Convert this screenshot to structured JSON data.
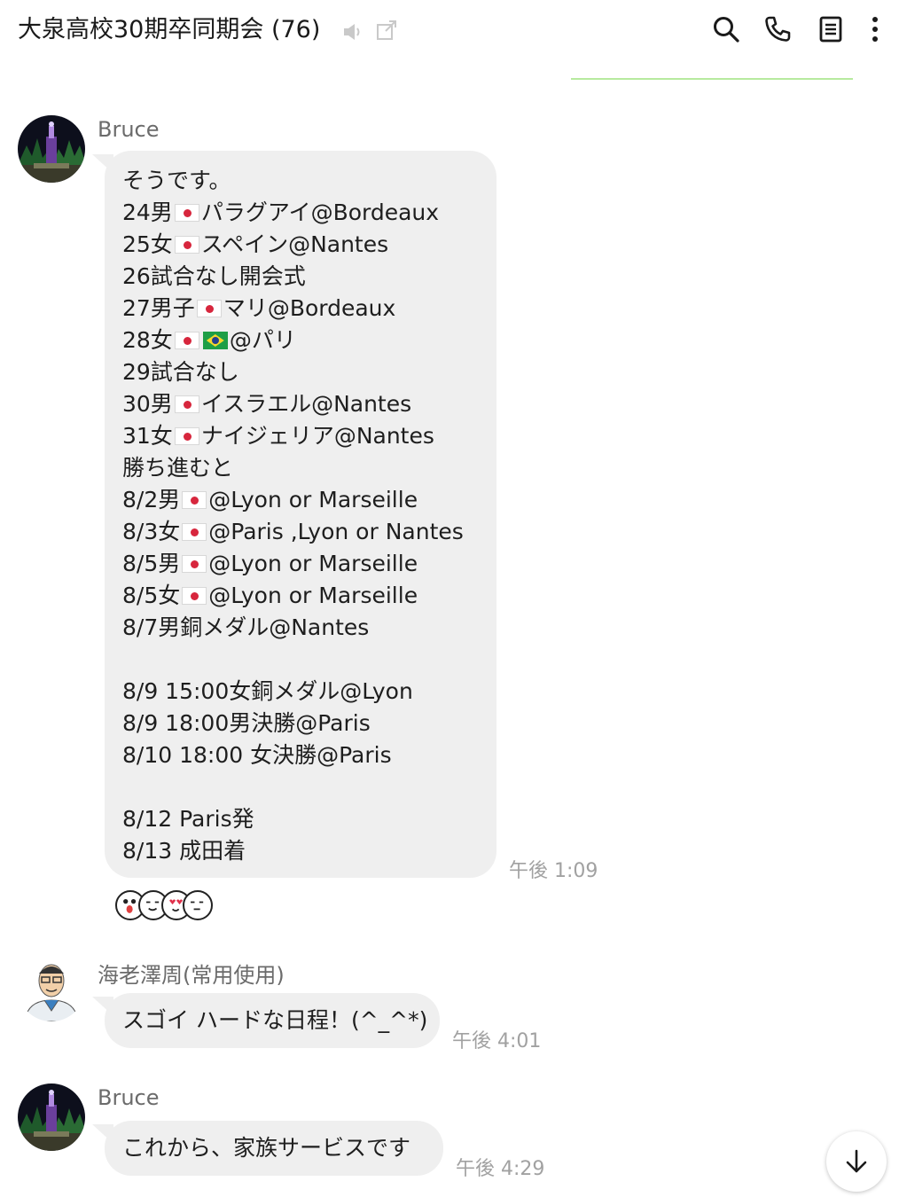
{
  "header": {
    "title": "大泉高校30期卒同期会 (76)",
    "icons": [
      "mute-icon",
      "external-link-icon",
      "search-icon",
      "phone-icon",
      "notes-icon",
      "more-vertical-icon"
    ]
  },
  "messages": [
    {
      "sender": "Bruce",
      "time": "午後 1:09",
      "lines": [
        {
          "pre": "そうです。"
        },
        {
          "pre": "24男",
          "flags": [
            "jp"
          ],
          "post": "パラグアイ@Bordeaux"
        },
        {
          "pre": "25女",
          "flags": [
            "jp"
          ],
          "post": "スペイン@Nantes"
        },
        {
          "pre": "26試合なし開会式"
        },
        {
          "pre": "27男子",
          "flags": [
            "jp"
          ],
          "post": "マリ@Bordeaux"
        },
        {
          "pre": "28女",
          "flags": [
            "jp",
            "br"
          ],
          "post": "@パリ"
        },
        {
          "pre": "29試合なし"
        },
        {
          "pre": "30男",
          "flags": [
            "jp"
          ],
          "post": "イスラエル@Nantes"
        },
        {
          "pre": "31女",
          "flags": [
            "jp"
          ],
          "post": "ナイジェリア@Nantes"
        },
        {
          "pre": "勝ち進むと"
        },
        {
          "pre": "8/2男",
          "flags": [
            "jp"
          ],
          "post": "@Lyon or Marseille"
        },
        {
          "pre": "8/3女",
          "flags": [
            "jp"
          ],
          "post": "@Paris ,Lyon or Nantes"
        },
        {
          "pre": "8/5男",
          "flags": [
            "jp"
          ],
          "post": "@Lyon or Marseille"
        },
        {
          "pre": "8/5女",
          "flags": [
            "jp"
          ],
          "post": "@Lyon or Marseille"
        },
        {
          "pre": "8/7男銅メダル@Nantes"
        },
        {
          "pre": ""
        },
        {
          "pre": "8/9 15:00女銅メダル@Lyon"
        },
        {
          "pre": "8/9 18:00男決勝@Paris"
        },
        {
          "pre": "8/10 18:00 女決勝@Paris"
        },
        {
          "pre": ""
        },
        {
          "pre": "8/12 Paris発"
        },
        {
          "pre": "8/13 成田着"
        }
      ],
      "reactions": [
        "surprised-face-icon",
        "smiling-face-icon",
        "heart-eyes-face-icon",
        "smirk-face-icon"
      ]
    },
    {
      "sender": "海老澤周(常用使用)",
      "time": "午後 4:01",
      "text": "スゴイ ハードな日程！(^_^*)"
    },
    {
      "sender": "Bruce",
      "time": "午後 4:29",
      "text": "これから、家族サービスです"
    }
  ],
  "colors": {
    "bubble": "#efefef",
    "accent_line": "#b7ea9f",
    "time_text": "#a1a1a1",
    "sender_text": "#6b6b6b"
  }
}
